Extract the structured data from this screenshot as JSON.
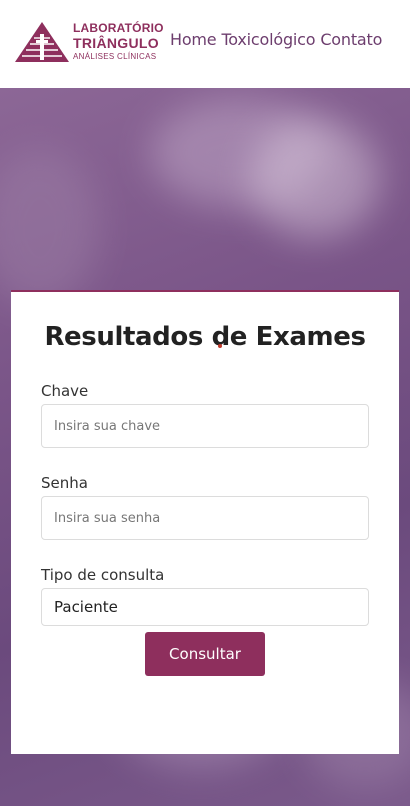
{
  "header": {
    "logo": {
      "line1": "LABORATÓRIO",
      "line2": "TRIÂNGULO",
      "line3": "ANÁLISES CLÍNICAS"
    },
    "nav": [
      {
        "label": "Home"
      },
      {
        "label": "Toxicológico"
      },
      {
        "label": "Contato"
      }
    ]
  },
  "form": {
    "title": "Resultados de Exames",
    "chave": {
      "label": "Chave",
      "placeholder": "Insira sua chave"
    },
    "senha": {
      "label": "Senha",
      "placeholder": "Insira sua senha"
    },
    "tipo": {
      "label": "Tipo de consulta",
      "value": "Paciente"
    },
    "submit_label": "Consultar"
  },
  "colors": {
    "brand": "#8e2f5d",
    "nav_text": "#6d3e6e",
    "hero_overlay": "#7a5588"
  },
  "icons": [
    "triangle-logo-icon"
  ]
}
